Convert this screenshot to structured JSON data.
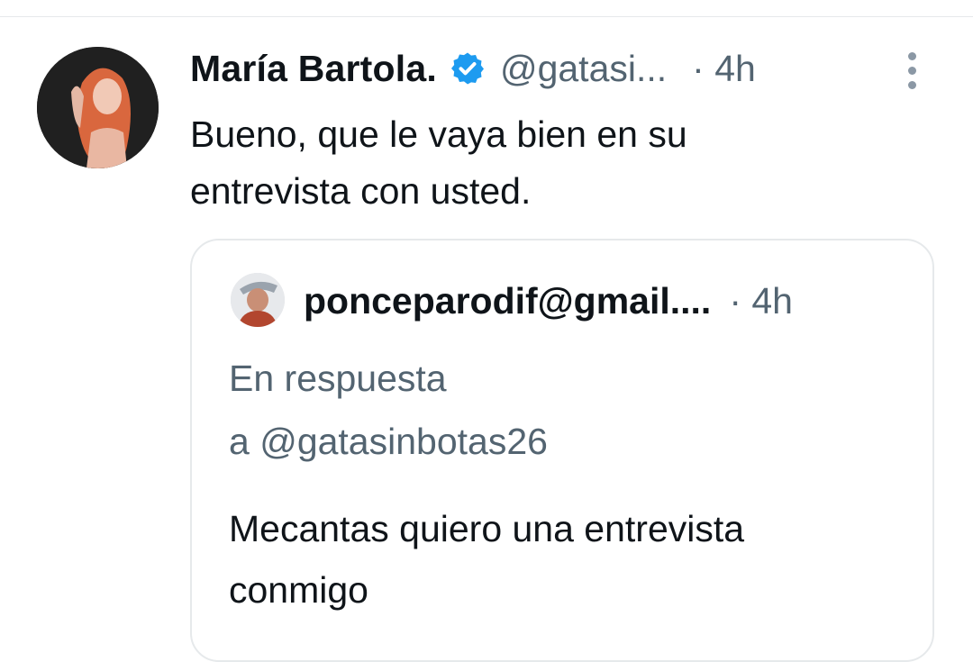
{
  "tweet": {
    "author_name": "María Bartola.",
    "handle": "@gatasi...",
    "time": "· 4h",
    "text_line1": "Bueno, que le vaya bien en su",
    "text_line2": "entrevista con usted.",
    "verified_icon": "verified-badge-icon",
    "more_icon": "more-options-icon"
  },
  "quote": {
    "author_name": "ponceparodif@gmail....",
    "time": "· 4h",
    "reply_line1": "En respuesta",
    "reply_line2": "a @gatasinbotas26",
    "text_line1": "Mecantas quiero una entrevista",
    "text_line2": "conmigo"
  },
  "colors": {
    "primary_text": "#0f1419",
    "secondary_text": "#536471",
    "verified_blue": "#1d9bf0",
    "border": "#e6e9eb"
  }
}
